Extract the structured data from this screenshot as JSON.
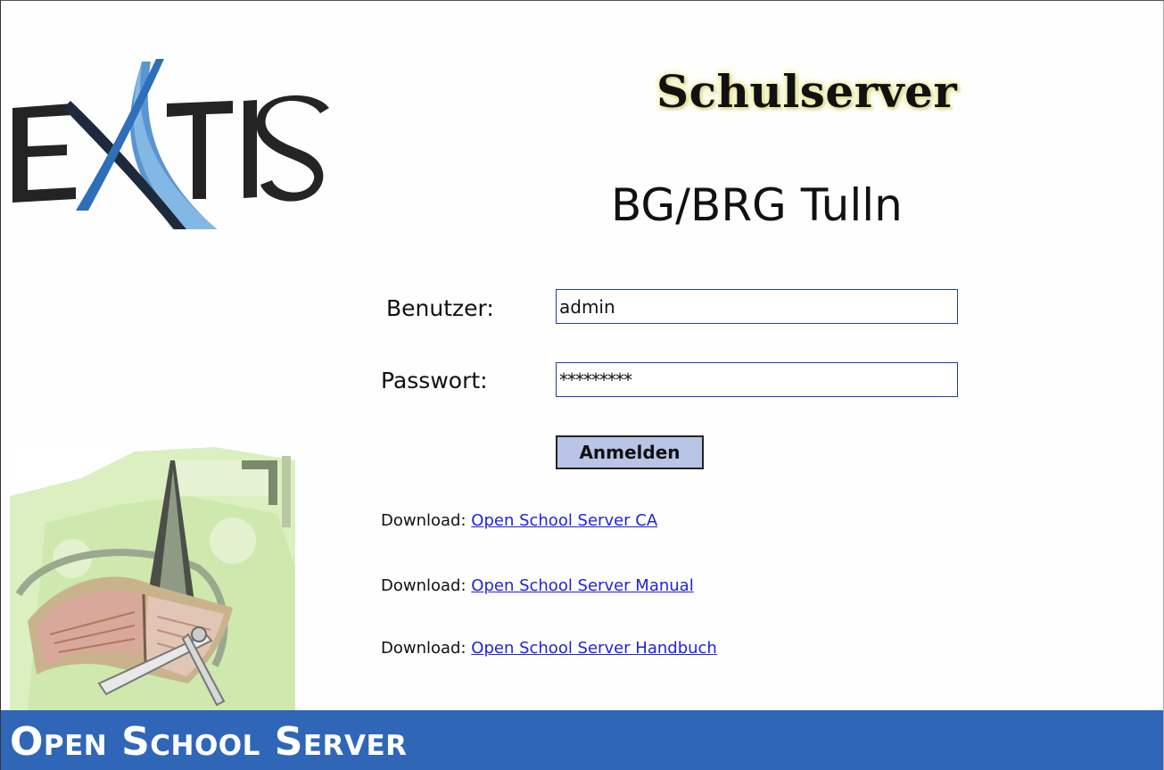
{
  "header": {
    "logo_text": "EXTIS",
    "title": "Schulserver",
    "subtitle": "BG/BRG Tulln"
  },
  "login": {
    "user_label": "Benutzer:",
    "user_value": "admin",
    "password_label": "Passwort:",
    "password_value": "*********",
    "submit_label": "Anmelden"
  },
  "downloads": [
    {
      "prefix": "Download:",
      "link_text": "Open School Server CA"
    },
    {
      "prefix": "Download:",
      "link_text": "Open School Server Manual"
    },
    {
      "prefix": "Download:",
      "link_text": "Open School Server Handbuch"
    }
  ],
  "footer": {
    "brand": "Open School Server"
  },
  "icons": {
    "logo": "extis-logo-icon",
    "illustration": "school-book-compass-icon"
  },
  "colors": {
    "footer_bg": "#2f66b8",
    "button_bg": "#b9c4e6",
    "link": "#2222dd",
    "input_border": "#223ca8",
    "title_glow": "#e8e79a"
  }
}
